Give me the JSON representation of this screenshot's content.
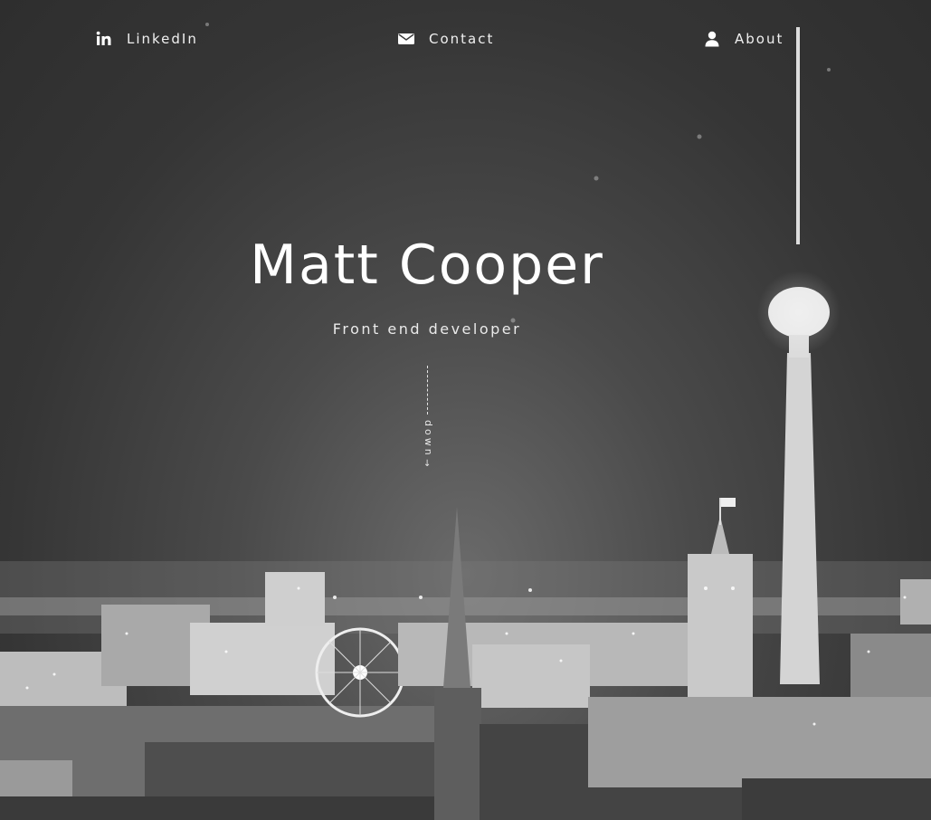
{
  "nav": {
    "items": [
      {
        "label": "LinkedIn",
        "icon": "linkedin-icon"
      },
      {
        "label": "Contact",
        "icon": "envelope-icon"
      },
      {
        "label": "About",
        "icon": "user-icon"
      }
    ]
  },
  "hero": {
    "title": "Matt Cooper",
    "subtitle": "Front end developer",
    "scroll_label": "down",
    "scroll_arrow": "↓"
  },
  "colors": {
    "text": "#ffffff",
    "sky": "#3a3a3a"
  }
}
